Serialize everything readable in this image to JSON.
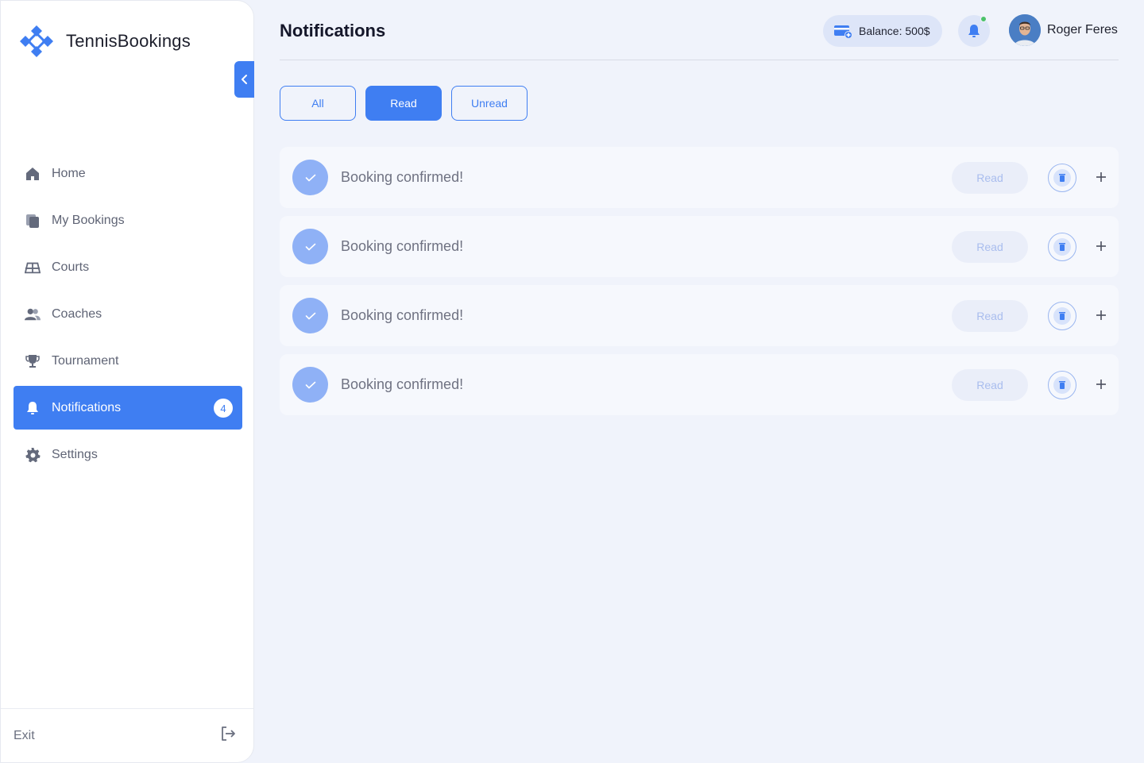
{
  "app": {
    "name": "TennisBookings"
  },
  "sidebar": {
    "items": [
      {
        "label": "Home",
        "icon": "home-icon"
      },
      {
        "label": "My Bookings",
        "icon": "bookings-icon"
      },
      {
        "label": "Courts",
        "icon": "court-icon"
      },
      {
        "label": "Coaches",
        "icon": "users-icon"
      },
      {
        "label": "Tournament",
        "icon": "trophy-icon"
      },
      {
        "label": "Notifications",
        "icon": "bell-icon",
        "active": true,
        "badge": "4"
      },
      {
        "label": "Settings",
        "icon": "gear-icon"
      }
    ],
    "exit_label": "Exit"
  },
  "header": {
    "title": "Notifications",
    "balance_label": "Balance: 500$",
    "user_name": "Roger Feres"
  },
  "filters": {
    "all": "All",
    "read": "Read",
    "unread": "Unread",
    "selected": "Read"
  },
  "notifications": [
    {
      "text": "Booking confirmed!",
      "read_label": "Read"
    },
    {
      "text": "Booking confirmed!",
      "read_label": "Read"
    },
    {
      "text": "Booking confirmed!",
      "read_label": "Read"
    },
    {
      "text": "Booking confirmed!",
      "read_label": "Read"
    }
  ],
  "colors": {
    "accent": "#3f7ef2",
    "background": "#f0f3fb",
    "status_online": "#4cc26a"
  }
}
